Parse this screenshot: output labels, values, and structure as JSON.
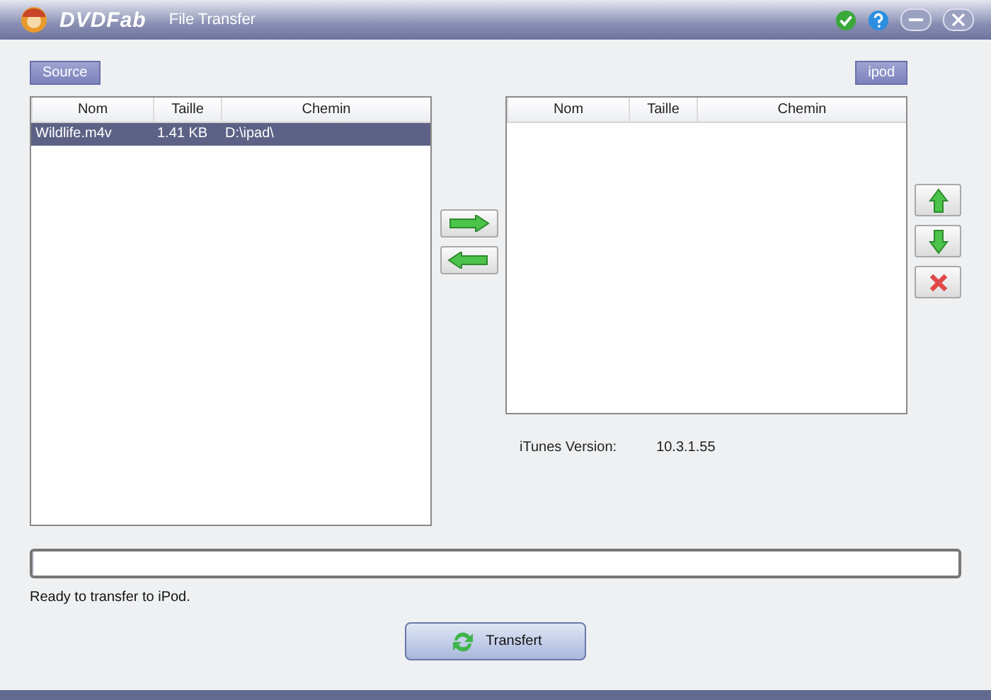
{
  "window": {
    "brand": "DVDFab",
    "title": "File Transfer"
  },
  "source": {
    "label": "Source",
    "columns": [
      "Nom",
      "Taille",
      "Chemin"
    ],
    "rows": [
      {
        "cells": [
          "Wildlife.m4v",
          "1.41 KB",
          "D:\\ipad\\"
        ],
        "selected": true
      }
    ]
  },
  "target": {
    "label": "ipod",
    "columns": [
      "Nom",
      "Taille",
      "Chemin"
    ]
  },
  "itunes": {
    "label": "iTunes Version:",
    "value": "10.3.1.55"
  },
  "progress": {
    "level": 0
  },
  "status": "Ready to transfer to iPod.",
  "transfer_button": "Transfert"
}
